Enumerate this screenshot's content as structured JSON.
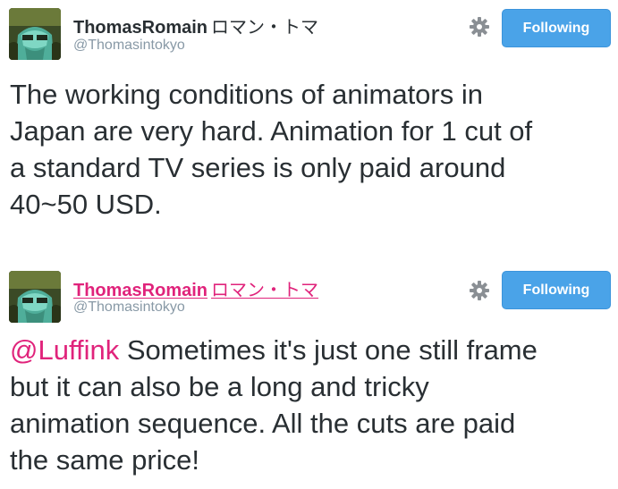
{
  "tweets": [
    {
      "display_name": "ThomasRomain",
      "display_name_jp": "ロマン・トマ",
      "handle": "@Thomasintokyo",
      "follow_label": "Following",
      "text_lines": [
        "The working conditions of animators in",
        "Japan are very hard. Animation for 1 cut of",
        "a standard TV series is only paid around",
        "40~50 USD."
      ]
    },
    {
      "display_name": "ThomasRomain",
      "display_name_jp": "ロマン・トマ",
      "handle": "@Thomasintokyo",
      "follow_label": "Following",
      "mention": "@Luffink",
      "text_lines": [
        " Sometimes it's just one still frame",
        "but it can also be a long and tricky",
        "animation sequence. All the cuts are paid",
        "the same price!"
      ]
    }
  ],
  "colors": {
    "follow_button": "#4aa3e8",
    "name_link_hover": "#e0237b",
    "mention": "#e0237b",
    "handle": "#8899a6",
    "text": "#292f33"
  },
  "icons": {
    "settings": "gear-icon"
  }
}
